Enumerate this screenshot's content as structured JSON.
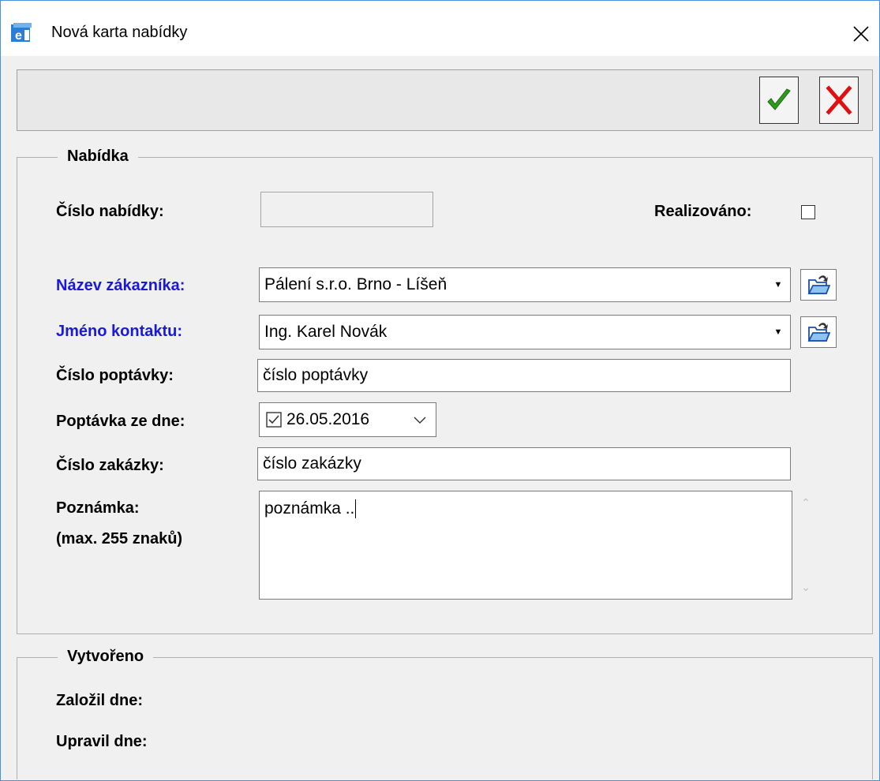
{
  "window": {
    "title": "Nová karta nabídky",
    "icons": {
      "app": "app-logo-icon",
      "close": "close-icon"
    }
  },
  "toolbar": {
    "ok_icon": "green-checkmark-icon",
    "cancel_icon": "red-x-icon"
  },
  "offer": {
    "legend": "Nabídka",
    "offer_number_label": "Číslo nabídky:",
    "offer_number_value": "",
    "realized_label": "Realizováno:",
    "realized_checked": false,
    "customer_label": "Název zákazníka:",
    "customer_value": "Pálení s.r.o. Brno - Líšeň",
    "contact_label": "Jméno kontaktu:",
    "contact_value": "Ing. Karel Novák",
    "inquiry_number_label": "Číslo poptávky:",
    "inquiry_number_value": "číslo poptávky",
    "inquiry_date_label": "Poptávka ze dne:",
    "inquiry_date_checked": true,
    "inquiry_date_value": "26.05.2016",
    "order_number_label": "Číslo zakázky:",
    "order_number_value": "číslo zakázky",
    "note_label_1": "Poznámka:",
    "note_label_2": "(max. 255 znaků)",
    "note_value": "poznámka .."
  },
  "created": {
    "legend": "Vytvořeno",
    "created_label": "Založil dne:",
    "modified_label": "Upravil dne:"
  },
  "colors": {
    "required_label": "#1a1ad6",
    "ok_green": "#2e9a1e",
    "cancel_red": "#e01010"
  }
}
